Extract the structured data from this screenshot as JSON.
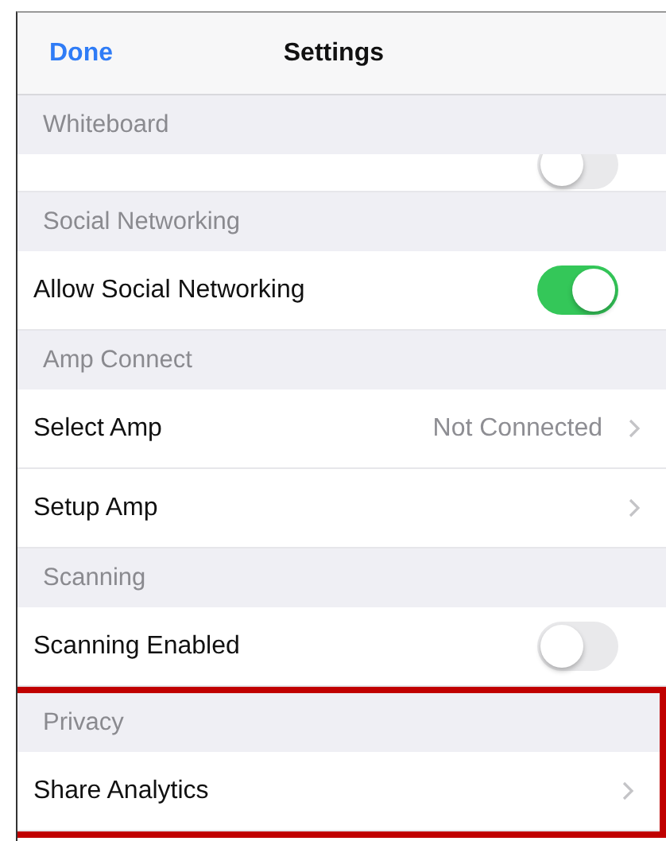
{
  "nav_bar": {
    "left_button": "Done",
    "title": "Settings"
  },
  "sections": [
    {
      "header": "Whiteboard",
      "highlighted": false,
      "rows": [
        {
          "kind": "partial_toggle",
          "on": false
        }
      ]
    },
    {
      "header": "Social Networking",
      "highlighted": false,
      "rows": [
        {
          "kind": "toggle",
          "label": "Allow Social Networking",
          "on": true
        }
      ]
    },
    {
      "header": "Amp Connect",
      "highlighted": false,
      "rows": [
        {
          "kind": "link",
          "label": "Select Amp",
          "value": "Not Connected"
        },
        {
          "kind": "link",
          "label": "Setup Amp"
        }
      ]
    },
    {
      "header": "Scanning",
      "highlighted": false,
      "rows": [
        {
          "kind": "toggle",
          "label": "Scanning Enabled",
          "on": false
        }
      ]
    },
    {
      "header": "Privacy",
      "highlighted": true,
      "rows": [
        {
          "kind": "link",
          "label": "Share Analytics"
        }
      ]
    }
  ]
}
